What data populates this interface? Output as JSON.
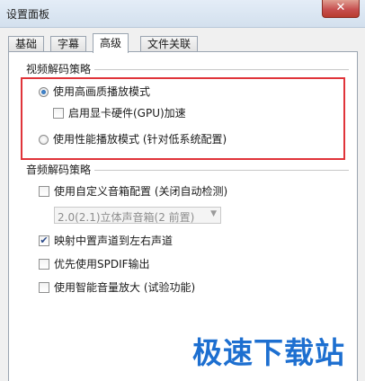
{
  "window": {
    "title": "设置面板",
    "close_label": "✕"
  },
  "tabs": [
    {
      "label": "基础",
      "active": false
    },
    {
      "label": "字幕",
      "active": false
    },
    {
      "label": "高级",
      "active": true
    },
    {
      "label": "文件关联",
      "active": false
    }
  ],
  "video": {
    "group_title": "视频解码策略",
    "high_quality": {
      "label": "使用高画质播放模式",
      "checked": true
    },
    "gpu": {
      "label": "启用显卡硬件(GPU)加速",
      "checked": false
    },
    "performance": {
      "label": "使用性能播放模式 (针对低系统配置)",
      "checked": false
    }
  },
  "audio": {
    "group_title": "音频解码策略",
    "custom_config": {
      "label": "使用自定义音箱配置 (关闭自动检测)",
      "checked": false
    },
    "speaker_select": {
      "value": "2.0(2.1)立体声音箱(2 前置)"
    },
    "center_map": {
      "label": "映射中置声道到左右声道",
      "checked": true,
      "mark": "✔"
    },
    "spdif": {
      "label": "优先使用SPDIF输出",
      "checked": false
    },
    "smart_volume": {
      "label": "使用智能音量放大 (试验功能)",
      "checked": false
    }
  },
  "watermark": "极速下载站",
  "colors": {
    "highlight": "#e0343a",
    "watermark": "#1d6fd0",
    "close": "#c75050"
  }
}
